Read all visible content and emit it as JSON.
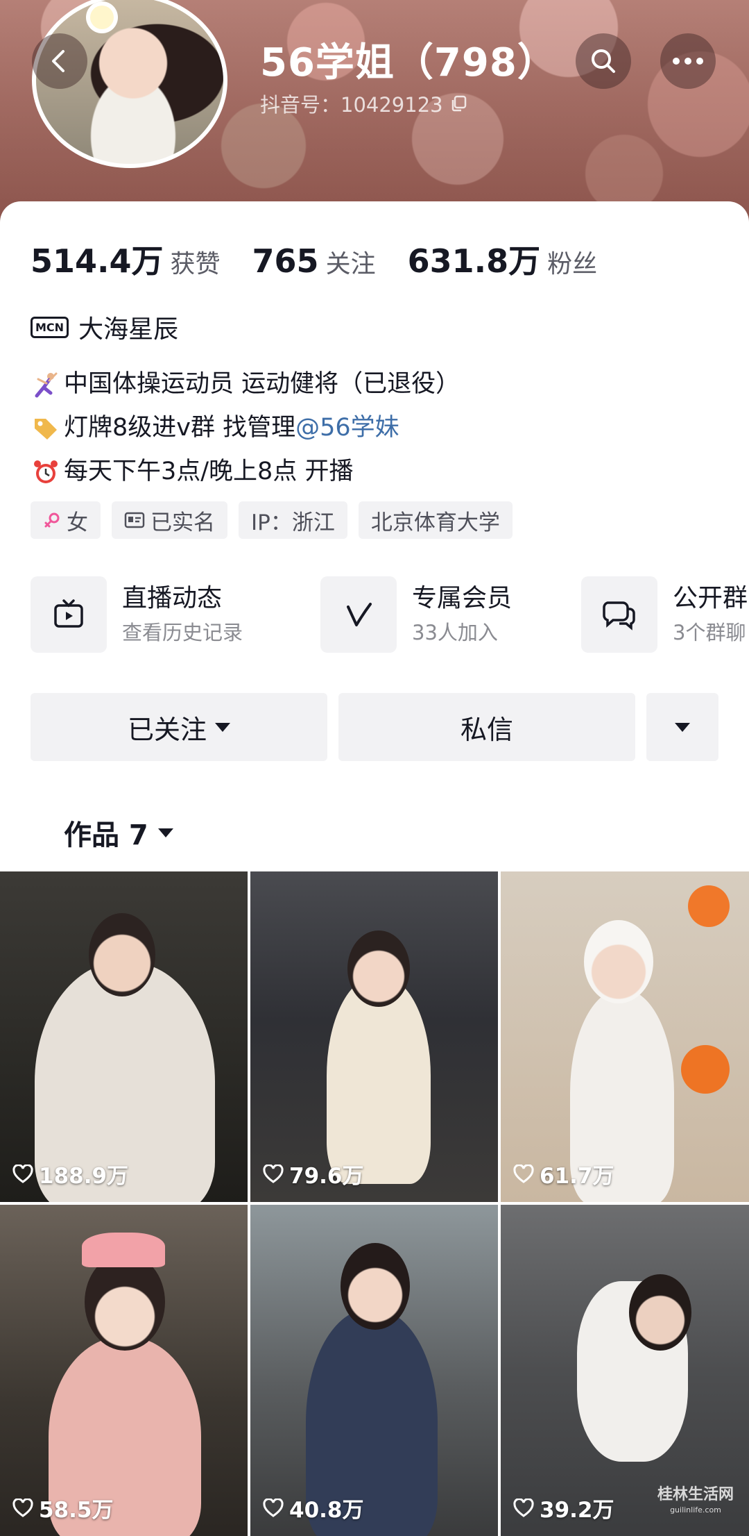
{
  "profile": {
    "nickname": "56学姐（798）",
    "douyin_id": "抖音号：10429123"
  },
  "stats": [
    {
      "value": "514.4万",
      "label": "获赞"
    },
    {
      "value": "765",
      "label": "关注"
    },
    {
      "value": "631.8万",
      "label": "粉丝"
    }
  ],
  "mcn": {
    "badge": "MCN",
    "name": "大海星辰"
  },
  "bio": {
    "line1": "中国体操运动员 运动健将（已退役）",
    "line2_prefix": "灯牌8级进v群 找管理",
    "line2_mention": "@56学妹",
    "line3": "每天下午3点/晚上8点 开播"
  },
  "tags": {
    "gender": "女",
    "verified": "已实名",
    "ip": "IP：浙江",
    "school": "北京体育大学"
  },
  "features": [
    {
      "title": "直播动态",
      "subtitle": "查看历史记录",
      "icon": "tv-icon"
    },
    {
      "title": "专属会员",
      "subtitle": "33人加入",
      "icon": "v-icon"
    },
    {
      "title": "公开群",
      "subtitle": "3个群聊",
      "icon": "chat-icon"
    }
  ],
  "actions": {
    "follow": "已关注",
    "message": "私信"
  },
  "works_tab": "作品 7",
  "videos": [
    {
      "likes": "188.9万"
    },
    {
      "likes": "79.6万"
    },
    {
      "likes": "61.7万"
    },
    {
      "likes": "58.5万"
    },
    {
      "likes": "40.8万"
    },
    {
      "likes": "39.2万"
    }
  ],
  "watermark": {
    "main": "桂林生活网",
    "sub": "guilinlife.com"
  }
}
